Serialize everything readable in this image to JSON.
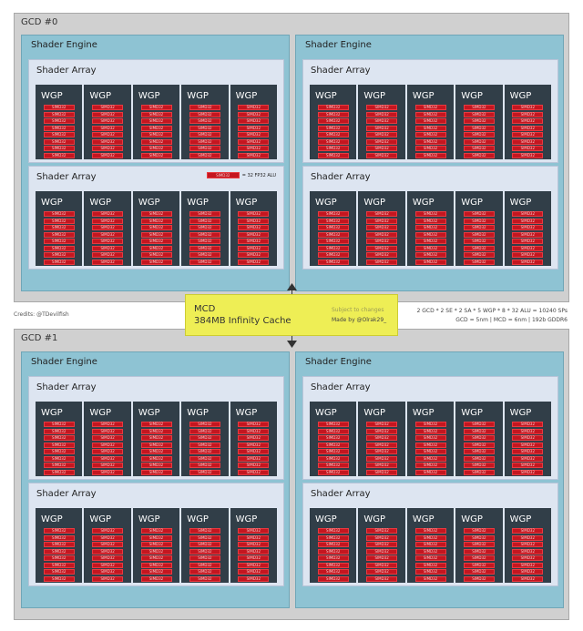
{
  "gcds": [
    {
      "label": "GCD #0"
    },
    {
      "label": "GCD #1"
    }
  ],
  "shader_engine_label": "Shader Engine",
  "shader_array_label": "Shader Array",
  "wgp_label": "WGP",
  "simd_label": "SIMD32",
  "legend": {
    "swatch": "SIMD32",
    "text": "= 32 FP32 ALU"
  },
  "mcd": {
    "title": "MCD",
    "cache": "384MB Infinity Cache",
    "note": "Subject to changes",
    "made_by": "Made by @Olrak29_"
  },
  "credits": "Credits:  @TDevilfish",
  "spec": {
    "line1": "2 GCD * 2 SE * 2 SA * 5 WGP * 8 * 32 ALU = 10240 SPs",
    "line2": "GCD = 5nm  |  MCD = 6nm  |  192b GDDR6"
  },
  "colors": {
    "gcd_bg": "#d0d0d0",
    "shader_engine_bg": "#8ec3d3",
    "shader_array_bg": "#dde5f1",
    "wgp_bg": "#313e48",
    "simd": "#c41620",
    "mcd_bg": "#eeee55"
  },
  "structure": {
    "shader_engines_per_gcd": 2,
    "shader_arrays_per_engine": 2,
    "wgps_per_array": 5,
    "simds_per_wgp": 8
  }
}
